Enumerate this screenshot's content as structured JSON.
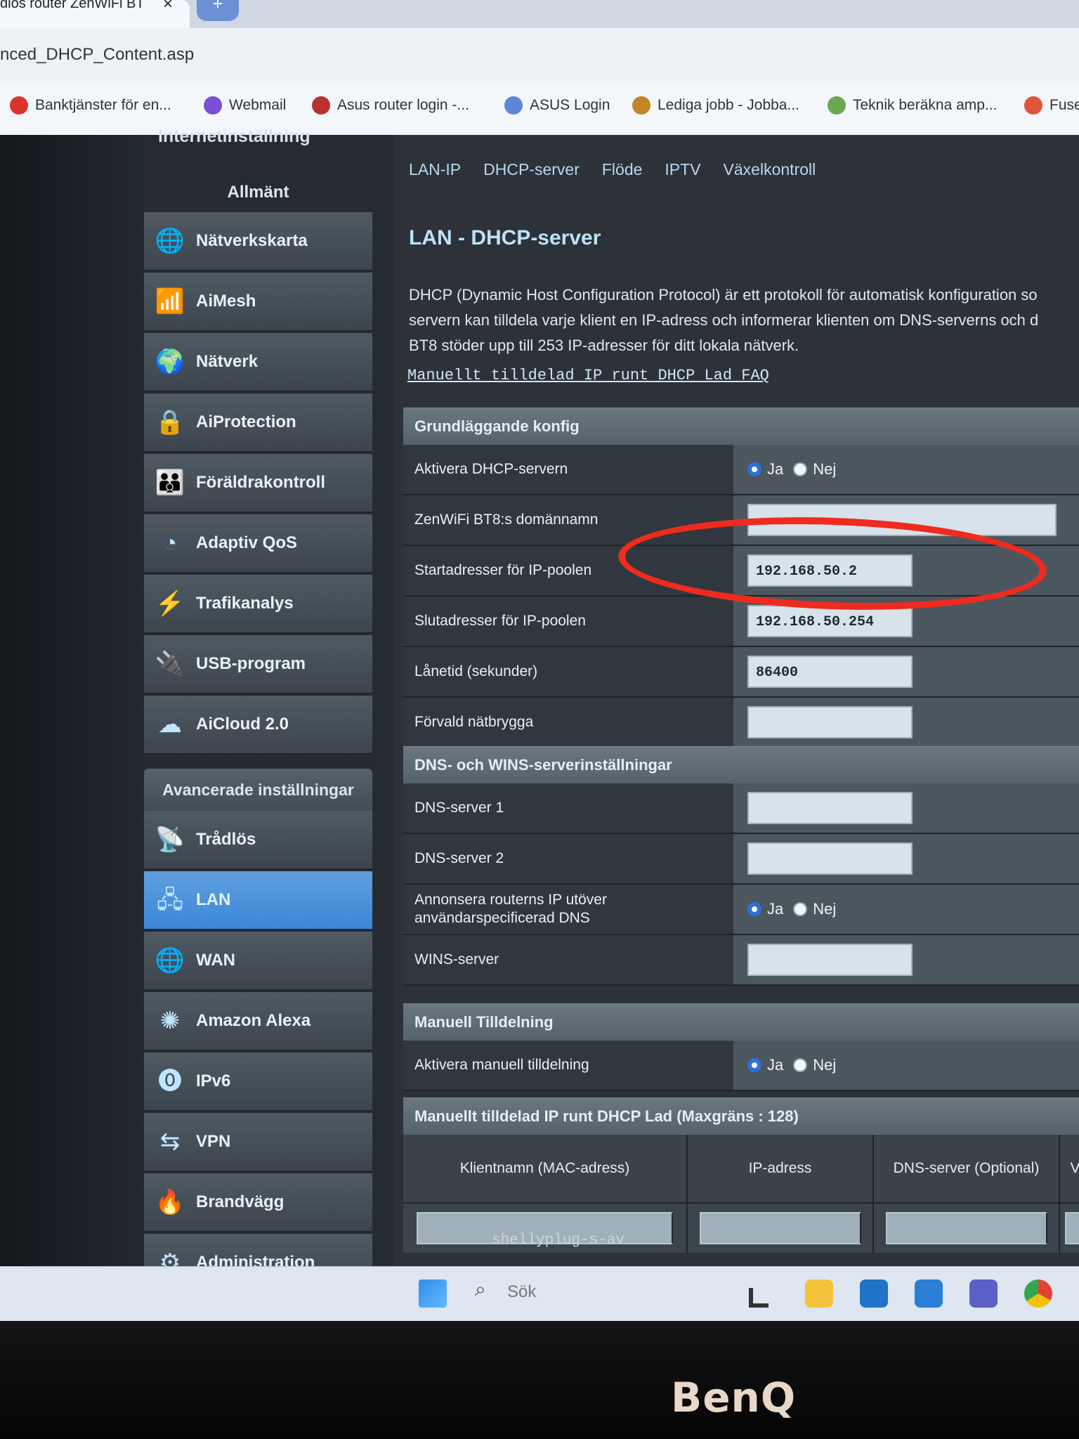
{
  "browser": {
    "tab_title": "dlos router ZenWiFi BT",
    "tab_close": "×",
    "new_tab": "+",
    "url": "nced_DHCP_Content.asp",
    "bookmarks": [
      {
        "label": "Banktjänster för en...",
        "color": "#d9362b"
      },
      {
        "label": "Webmail",
        "color": "#7a4fd6"
      },
      {
        "label": "Asus router login -...",
        "color": "#b7322c"
      },
      {
        "label": "ASUS Login",
        "color": "#5d86d8"
      },
      {
        "label": "Lediga jobb - Jobba...",
        "color": "#c3842a"
      },
      {
        "label": "Teknik beräkna amp...",
        "color": "#6aa84f"
      },
      {
        "label": "Fuse",
        "color": "#e0553a"
      }
    ]
  },
  "sidebar": {
    "top_item": "Internetinställning",
    "general_header": "Allmänt",
    "general_items": [
      {
        "label": "Nätverkskarta",
        "icon": "🌐"
      },
      {
        "label": "AiMesh",
        "icon": "📶"
      },
      {
        "label": "Nätverk",
        "icon": "🌍"
      },
      {
        "label": "AiProtection",
        "icon": "🔒"
      },
      {
        "label": "Föräldrakontroll",
        "icon": "👪"
      },
      {
        "label": "Adaptiv QoS",
        "icon": "◔"
      },
      {
        "label": "Trafikanalys",
        "icon": "⚡"
      },
      {
        "label": "USB-program",
        "icon": "🔌"
      },
      {
        "label": "AiCloud 2.0",
        "icon": "☁"
      }
    ],
    "advanced_header": "Avancerade inställningar",
    "advanced_items": [
      {
        "label": "Trådlös",
        "icon": "📡"
      },
      {
        "label": "LAN",
        "icon": "🖧"
      },
      {
        "label": "WAN",
        "icon": "🌐"
      },
      {
        "label": "Amazon Alexa",
        "icon": "✺"
      },
      {
        "label": "IPv6",
        "icon": "⓿"
      },
      {
        "label": "VPN",
        "icon": "⇆"
      },
      {
        "label": "Brandvägg",
        "icon": "🔥"
      },
      {
        "label": "Administration",
        "icon": "⚙"
      }
    ]
  },
  "content": {
    "tabs": [
      "LAN-IP",
      "DHCP-server",
      "Flöde",
      "IPTV",
      "Växelkontroll"
    ],
    "title": "LAN - DHCP-server",
    "desc_lines": [
      "DHCP (Dynamic Host Configuration Protocol) är ett protokoll för automatisk konfiguration so",
      "servern kan tilldela varje klient en IP-adress och informerar klienten om DNS-serverns och d",
      "BT8 stöder upp till 253 IP-adresser för ditt lokala nätverk."
    ],
    "faq_link": "Manuellt tilldelad IP runt DHCP Lad FAQ",
    "basic": {
      "header": "Grundläggande konfig",
      "enable_label": "Aktivera DHCP-servern",
      "yes": "Ja",
      "no": "Nej",
      "domain_label": "ZenWiFi BT8:s domännamn",
      "domain_value": "",
      "start_label": "Startadresser för IP-poolen",
      "start_value": "192.168.50.2",
      "end_label": "Slutadresser för IP-poolen",
      "end_value": "192.168.50.254",
      "lease_label": "Lånetid (sekunder)",
      "lease_value": "86400",
      "gateway_label": "Förvald nätbrygga",
      "gateway_value": ""
    },
    "dns": {
      "header": "DNS- och WINS-serverinställningar",
      "dns1_label": "DNS-server 1",
      "dns2_label": "DNS-server 2",
      "advertise_label_1": "Annonsera routerns IP utöver",
      "advertise_label_2": "användarspecificerad DNS",
      "wins_label": "WINS-server"
    },
    "manual": {
      "header": "Manuell Tilldelning",
      "enable_label": "Aktivera manuell tilldelning"
    },
    "table": {
      "header": "Manuellt tilldelad IP runt DHCP Lad (Maxgräns : 128)",
      "columns": [
        "Klientnamn (MAC-adress)",
        "IP-adress",
        "DNS-server (Optional)",
        "V"
      ],
      "first_client": "shellyplug-s-av"
    }
  },
  "taskbar": {
    "search": "Sök"
  },
  "monitor": {
    "brand": "BenQ"
  },
  "colors": {
    "highlight": "#ee2b1e",
    "active_menu": "#3d86d6"
  }
}
